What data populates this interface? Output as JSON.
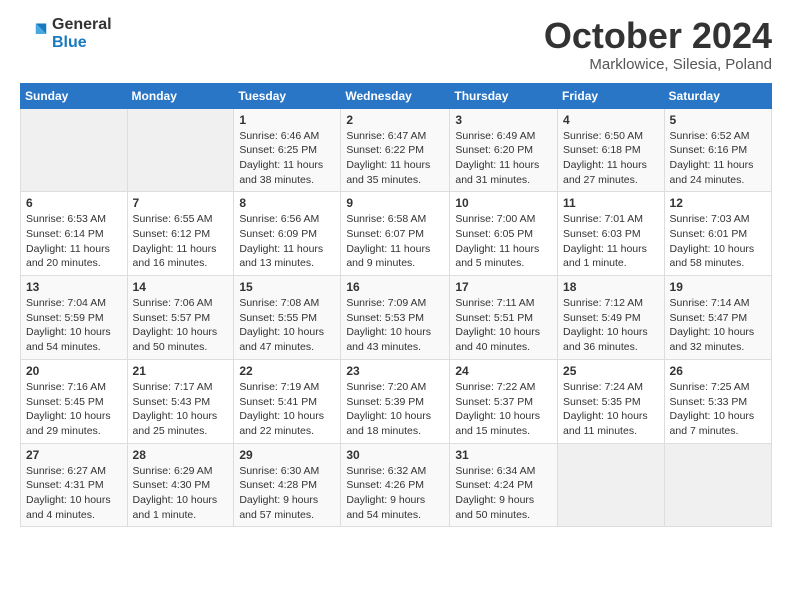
{
  "header": {
    "logo_general": "General",
    "logo_blue": "Blue",
    "month_title": "October 2024",
    "location": "Marklowice, Silesia, Poland"
  },
  "weekdays": [
    "Sunday",
    "Monday",
    "Tuesday",
    "Wednesday",
    "Thursday",
    "Friday",
    "Saturday"
  ],
  "weeks": [
    [
      {
        "day": "",
        "info": ""
      },
      {
        "day": "",
        "info": ""
      },
      {
        "day": "1",
        "info": "Sunrise: 6:46 AM\nSunset: 6:25 PM\nDaylight: 11 hours\nand 38 minutes."
      },
      {
        "day": "2",
        "info": "Sunrise: 6:47 AM\nSunset: 6:22 PM\nDaylight: 11 hours\nand 35 minutes."
      },
      {
        "day": "3",
        "info": "Sunrise: 6:49 AM\nSunset: 6:20 PM\nDaylight: 11 hours\nand 31 minutes."
      },
      {
        "day": "4",
        "info": "Sunrise: 6:50 AM\nSunset: 6:18 PM\nDaylight: 11 hours\nand 27 minutes."
      },
      {
        "day": "5",
        "info": "Sunrise: 6:52 AM\nSunset: 6:16 PM\nDaylight: 11 hours\nand 24 minutes."
      }
    ],
    [
      {
        "day": "6",
        "info": "Sunrise: 6:53 AM\nSunset: 6:14 PM\nDaylight: 11 hours\nand 20 minutes."
      },
      {
        "day": "7",
        "info": "Sunrise: 6:55 AM\nSunset: 6:12 PM\nDaylight: 11 hours\nand 16 minutes."
      },
      {
        "day": "8",
        "info": "Sunrise: 6:56 AM\nSunset: 6:09 PM\nDaylight: 11 hours\nand 13 minutes."
      },
      {
        "day": "9",
        "info": "Sunrise: 6:58 AM\nSunset: 6:07 PM\nDaylight: 11 hours\nand 9 minutes."
      },
      {
        "day": "10",
        "info": "Sunrise: 7:00 AM\nSunset: 6:05 PM\nDaylight: 11 hours\nand 5 minutes."
      },
      {
        "day": "11",
        "info": "Sunrise: 7:01 AM\nSunset: 6:03 PM\nDaylight: 11 hours\nand 1 minute."
      },
      {
        "day": "12",
        "info": "Sunrise: 7:03 AM\nSunset: 6:01 PM\nDaylight: 10 hours\nand 58 minutes."
      }
    ],
    [
      {
        "day": "13",
        "info": "Sunrise: 7:04 AM\nSunset: 5:59 PM\nDaylight: 10 hours\nand 54 minutes."
      },
      {
        "day": "14",
        "info": "Sunrise: 7:06 AM\nSunset: 5:57 PM\nDaylight: 10 hours\nand 50 minutes."
      },
      {
        "day": "15",
        "info": "Sunrise: 7:08 AM\nSunset: 5:55 PM\nDaylight: 10 hours\nand 47 minutes."
      },
      {
        "day": "16",
        "info": "Sunrise: 7:09 AM\nSunset: 5:53 PM\nDaylight: 10 hours\nand 43 minutes."
      },
      {
        "day": "17",
        "info": "Sunrise: 7:11 AM\nSunset: 5:51 PM\nDaylight: 10 hours\nand 40 minutes."
      },
      {
        "day": "18",
        "info": "Sunrise: 7:12 AM\nSunset: 5:49 PM\nDaylight: 10 hours\nand 36 minutes."
      },
      {
        "day": "19",
        "info": "Sunrise: 7:14 AM\nSunset: 5:47 PM\nDaylight: 10 hours\nand 32 minutes."
      }
    ],
    [
      {
        "day": "20",
        "info": "Sunrise: 7:16 AM\nSunset: 5:45 PM\nDaylight: 10 hours\nand 29 minutes."
      },
      {
        "day": "21",
        "info": "Sunrise: 7:17 AM\nSunset: 5:43 PM\nDaylight: 10 hours\nand 25 minutes."
      },
      {
        "day": "22",
        "info": "Sunrise: 7:19 AM\nSunset: 5:41 PM\nDaylight: 10 hours\nand 22 minutes."
      },
      {
        "day": "23",
        "info": "Sunrise: 7:20 AM\nSunset: 5:39 PM\nDaylight: 10 hours\nand 18 minutes."
      },
      {
        "day": "24",
        "info": "Sunrise: 7:22 AM\nSunset: 5:37 PM\nDaylight: 10 hours\nand 15 minutes."
      },
      {
        "day": "25",
        "info": "Sunrise: 7:24 AM\nSunset: 5:35 PM\nDaylight: 10 hours\nand 11 minutes."
      },
      {
        "day": "26",
        "info": "Sunrise: 7:25 AM\nSunset: 5:33 PM\nDaylight: 10 hours\nand 7 minutes."
      }
    ],
    [
      {
        "day": "27",
        "info": "Sunrise: 6:27 AM\nSunset: 4:31 PM\nDaylight: 10 hours\nand 4 minutes."
      },
      {
        "day": "28",
        "info": "Sunrise: 6:29 AM\nSunset: 4:30 PM\nDaylight: 10 hours\nand 1 minute."
      },
      {
        "day": "29",
        "info": "Sunrise: 6:30 AM\nSunset: 4:28 PM\nDaylight: 9 hours\nand 57 minutes."
      },
      {
        "day": "30",
        "info": "Sunrise: 6:32 AM\nSunset: 4:26 PM\nDaylight: 9 hours\nand 54 minutes."
      },
      {
        "day": "31",
        "info": "Sunrise: 6:34 AM\nSunset: 4:24 PM\nDaylight: 9 hours\nand 50 minutes."
      },
      {
        "day": "",
        "info": ""
      },
      {
        "day": "",
        "info": ""
      }
    ]
  ]
}
